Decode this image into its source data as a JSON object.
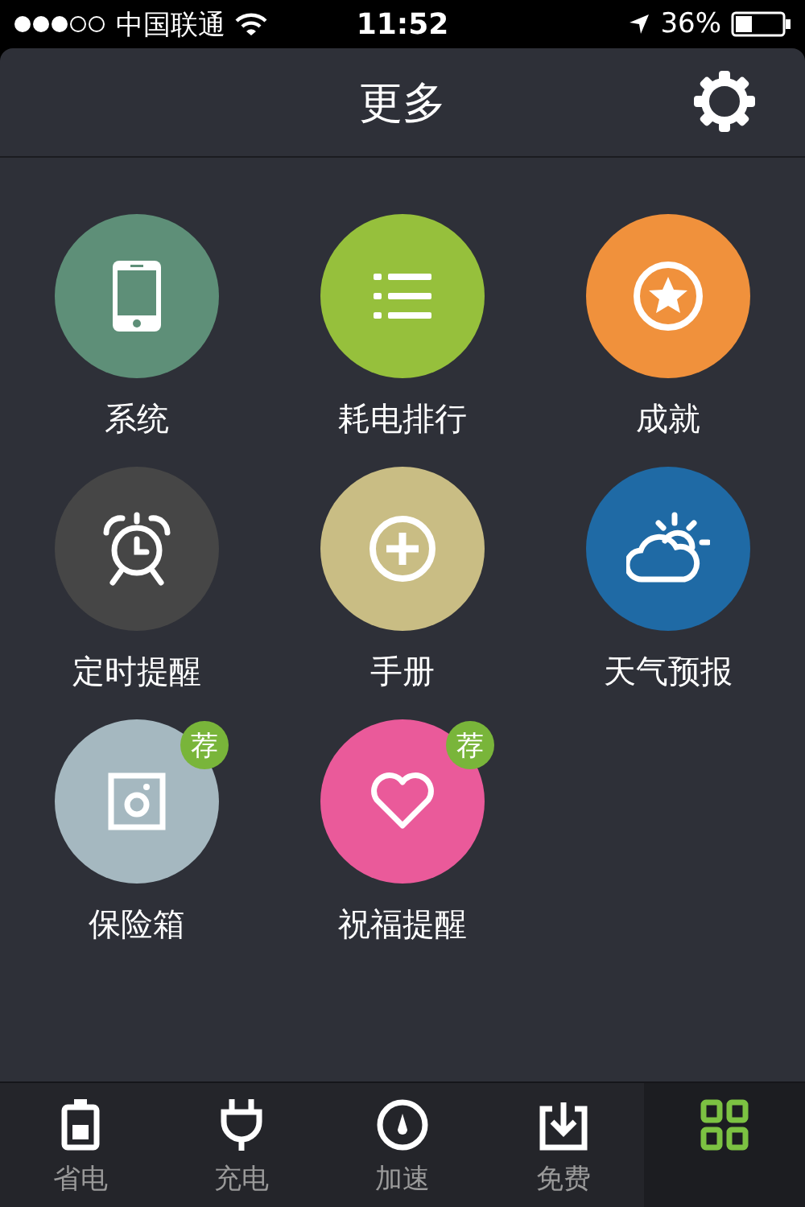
{
  "status_bar": {
    "carrier": "中国联通",
    "time": "11:52",
    "battery": "36%"
  },
  "header": {
    "title": "更多"
  },
  "items": [
    {
      "label": "系统",
      "kind": "phone",
      "color": "#5e8f78"
    },
    {
      "label": "耗电排行",
      "kind": "list",
      "color": "#96c03c"
    },
    {
      "label": "成就",
      "kind": "star",
      "color": "#f0913c"
    },
    {
      "label": "定时提醒",
      "kind": "alarm",
      "color": "#464646"
    },
    {
      "label": "手册",
      "kind": "plus",
      "color": "#c9bd84"
    },
    {
      "label": "天气预报",
      "kind": "weather",
      "color": "#1f6aa5"
    },
    {
      "label": "保险箱",
      "kind": "safe",
      "color": "#a5b8c0",
      "badge": "荐"
    },
    {
      "label": "祝福提醒",
      "kind": "heart",
      "color": "#ea5a9a",
      "badge": "荐"
    }
  ],
  "tabs": [
    {
      "label": "省电",
      "kind": "battery",
      "selected": false
    },
    {
      "label": "充电",
      "kind": "plug",
      "selected": false
    },
    {
      "label": "加速",
      "kind": "gauge",
      "selected": false
    },
    {
      "label": "免费",
      "kind": "download",
      "selected": false
    },
    {
      "kind": "grid",
      "selected": true
    }
  ]
}
